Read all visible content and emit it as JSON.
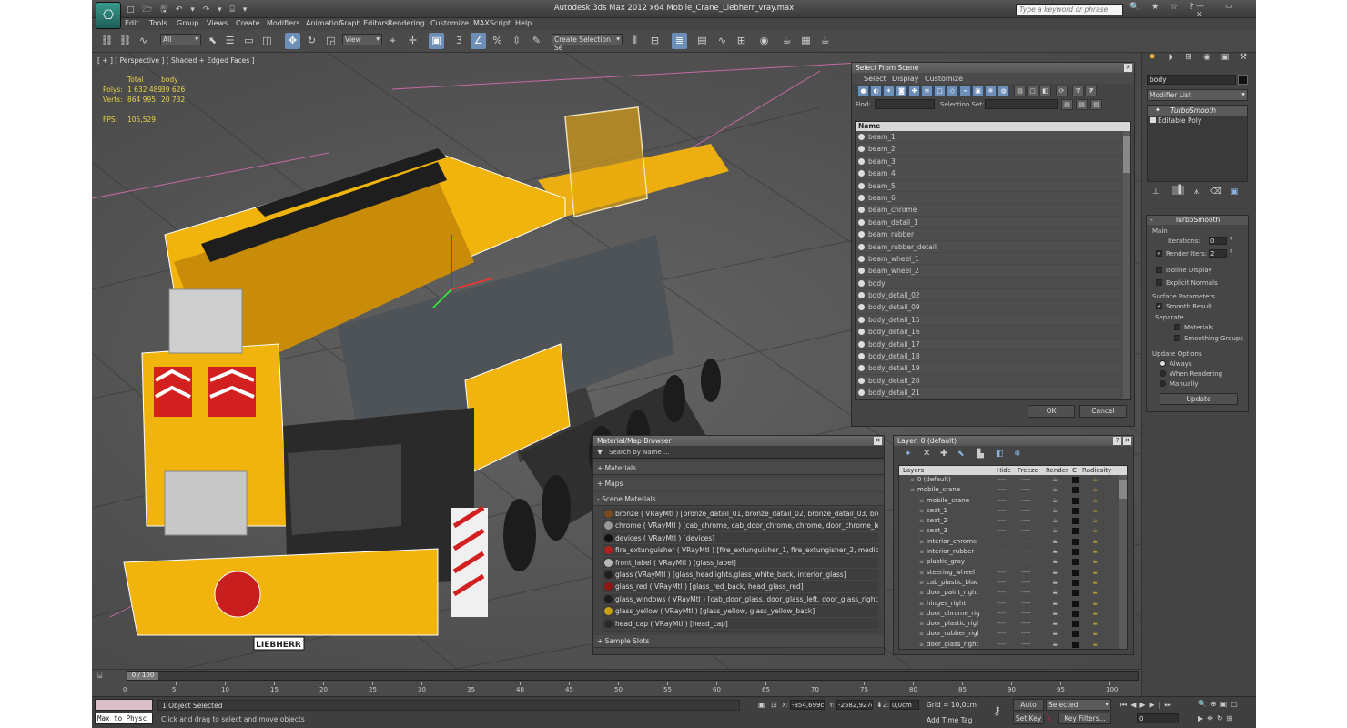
{
  "title": "Autodesk 3ds Max  2012 x64     Mobile_Crane_Liebherr_vray.max",
  "search_placeholder": "Type a keyword or phrase",
  "menu": [
    "Edit",
    "Tools",
    "Group",
    "Views",
    "Create",
    "Modifiers",
    "Animation",
    "Graph Editors",
    "Rendering",
    "Customize",
    "MAXScript",
    "Help"
  ],
  "toolbar": {
    "filter": "All",
    "ref_coord": "View",
    "selection_set": "Create Selection Se"
  },
  "viewport": {
    "label": "[ + ] [ Perspective ] [ Shaded + Edged Faces ]",
    "stats": {
      "col_total": "Total",
      "col_body": "body",
      "polys_label": "Polys:",
      "polys_total": "1 632 489",
      "polys_body": "39 626",
      "verts_label": "Verts:",
      "verts_total": "864 995",
      "verts_body": "20 732",
      "fps_label": "FPS:",
      "fps": "105,529"
    },
    "plate": "LIEBHERR"
  },
  "select_scene": {
    "title": "Select From Scene",
    "menus": [
      "Select",
      "Display",
      "Customize"
    ],
    "find_label": "Find:",
    "selection_set_label": "Selection Set:",
    "column": "Name",
    "items": [
      "beam_1",
      "beam_2",
      "beam_3",
      "beam_4",
      "beam_5",
      "beam_6",
      "beam_chrome",
      "beam_detail_1",
      "beam_rubber",
      "beam_rubber_detail",
      "beam_wheel_1",
      "beam_wheel_2",
      "body",
      "body_detail_02",
      "body_detail_09",
      "body_detail_15",
      "body_detail_16",
      "body_detail_17",
      "body_detail_18",
      "body_detail_19",
      "body_detail_20",
      "body_detail_21"
    ],
    "ok": "OK",
    "cancel": "Cancel"
  },
  "mat_browser": {
    "title": "Material/Map Browser",
    "search": "Search by Name ...",
    "rollouts": {
      "materials": "+ Materials",
      "maps": "+ Maps",
      "scene": "- Scene Materials",
      "samples": "+ Sample Slots"
    },
    "items": [
      {
        "text": "bronze  ( VRayMtl )  [bronze_datail_01, bronze_datail_02, bronze_datail_03, bro...",
        "color": "#7a4a20"
      },
      {
        "text": "chrome  ( VRayMtl )  [cab_chrome, cab_door_chrome, chrome, door_chrome_lef...",
        "color": "#999999"
      },
      {
        "text": "devices  ( VRayMtl )  [devices]",
        "color": "#111111"
      },
      {
        "text": "fire_extunguisher  ( VRayMtl )  [fire_extunguisher_1, fire_extungisher_2, medica...",
        "color": "#b02020"
      },
      {
        "text": "front_label  ( VRayMtl )  [glass_label]",
        "color": "#b8b8b8"
      },
      {
        "text": "glass  (VRayMtl )  [glass_headlights,glass_white_back, interior_glass]",
        "color": "#202020"
      },
      {
        "text": "glass_red  ( VRayMtl )  [glass_red_back, head_glass_red]",
        "color": "#901515"
      },
      {
        "text": "glass_windows  ( VRayMtl )  [cab_door_glass, door_glass_left, door_glass_right,...",
        "color": "#1c1c1c"
      },
      {
        "text": "glass_yellow  ( VRayMtl )  [glass_yellow, glass_yellow_back]",
        "color": "#c8a010"
      },
      {
        "text": "head_cap  ( VRayMtl )  [head_cap]",
        "color": "#2a2a2a"
      }
    ]
  },
  "layer_manager": {
    "title": "Layer: 0 (default)",
    "columns": [
      "Layers",
      "Hide",
      "Freeze",
      "Render",
      "C",
      "Radiosity"
    ],
    "rows": [
      "0 (default)",
      "mobile_crane",
      "mobile_crane",
      "seat_1",
      "seat_2",
      "seat_3",
      "interior_chrome",
      "interior_rubber",
      "plastic_gray",
      "steering_wheel",
      "cab_plastic_blac",
      "door_paint_right",
      "hinges_right",
      "door_chrome_rig",
      "door_plastic_rigl",
      "door_rubber_rigl",
      "door_glass_right"
    ],
    "dash": "----"
  },
  "command_panel": {
    "object_name": "body",
    "modifier_list": "Modifier List",
    "stack": [
      "TurboSmooth",
      "Editable Poly"
    ],
    "turbosmooth": {
      "title": "TurboSmooth",
      "main": "Main",
      "iterations_label": "Iterations:",
      "iterations": "0",
      "render_iters_label": "Render Iters:",
      "render_iters": "2",
      "isoline": "Isoline Display",
      "explicit": "Explicit Normals",
      "surface": "Surface Parameters",
      "smooth_result": "Smooth Result",
      "separate": "Separate",
      "materials": "Materials",
      "smoothing_groups": "Smoothing Groups",
      "update_options": "Update Options",
      "always": "Always",
      "when_rendering": "When Rendering",
      "manually": "Manually",
      "update": "Update"
    }
  },
  "timeline": {
    "frame": "0 / 100",
    "ticks": [
      "0",
      "5",
      "10",
      "15",
      "20",
      "25",
      "30",
      "35",
      "40",
      "45",
      "50",
      "55",
      "60",
      "65",
      "70",
      "75",
      "80",
      "85",
      "90",
      "95",
      "100"
    ]
  },
  "status": {
    "maxscript": "Max to Physc",
    "selected": "1 Object Selected",
    "prompt": "Click and drag to select and move objects",
    "x_label": "X:",
    "x": "-854,699cr",
    "y_label": "Y:",
    "y": "-2582,927c",
    "z_label": "Z:",
    "z": "0,0cm",
    "grid": "Grid = 10,0cm",
    "add_time_tag": "Add Time Tag",
    "auto_key": "Auto Key",
    "set_key": "Set Key",
    "key_mode": "Selected",
    "key_filters": "Key Filters...",
    "current_frame": "0"
  }
}
